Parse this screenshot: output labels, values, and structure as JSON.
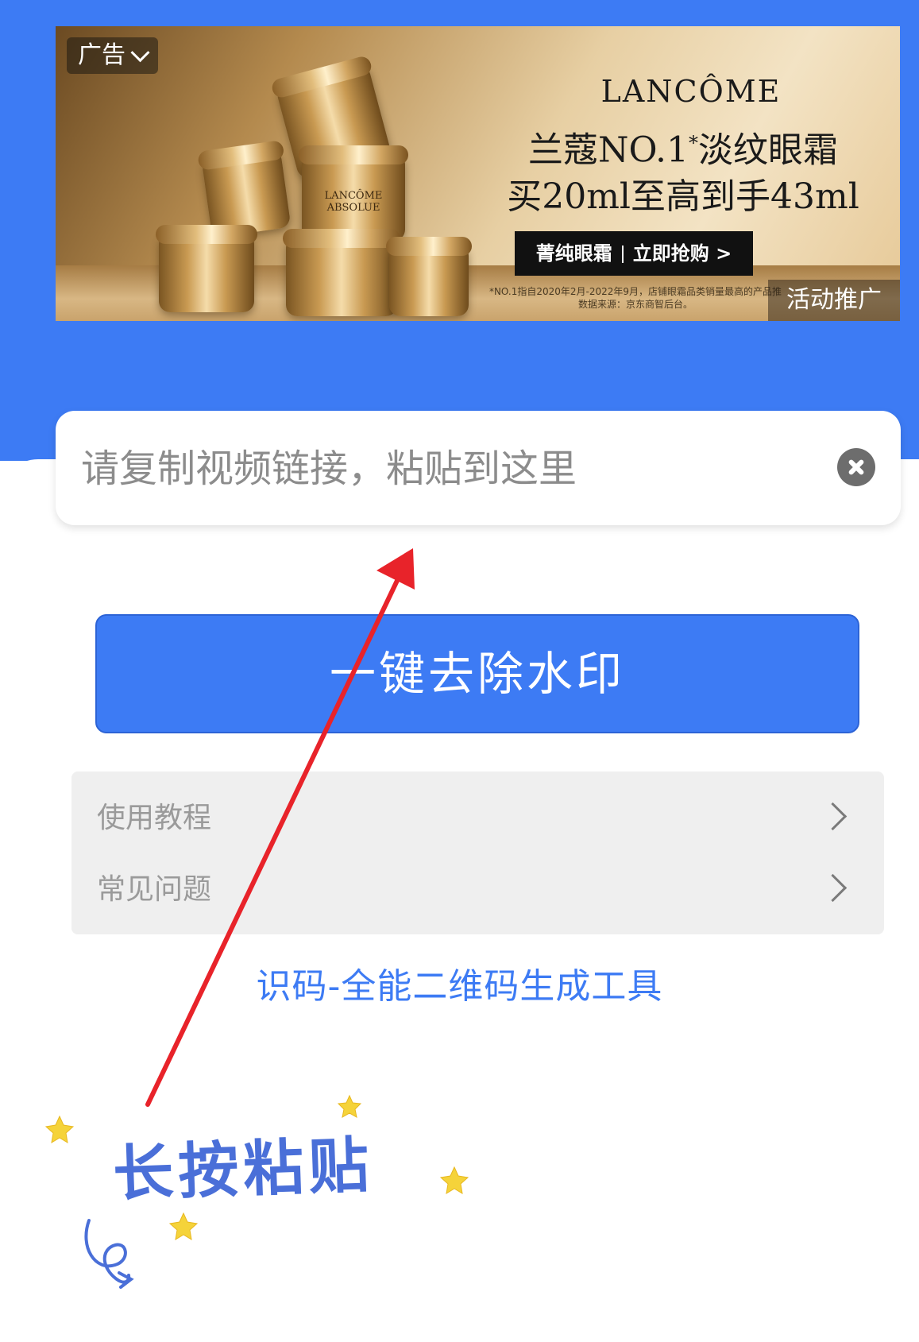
{
  "ad": {
    "tag_label": "广告",
    "brand": "LANCÔME",
    "headline_line1_a": "兰蔻NO.1",
    "headline_line1_sup": "*",
    "headline_line1_b": "淡纹眼霜",
    "headline_line2": "买20ml至高到手43ml",
    "cta_left": "菁纯眼霜",
    "cta_right": "立即抢购 >",
    "footnote_line1": "*NO.1指自2020年2月-2022年9月，店铺眼霜品类销量最高的产品推",
    "footnote_line2": "数据来源：京东商智后台。",
    "promo_label": "活动推广",
    "jar_label": "LANCÔME ABSOLUE"
  },
  "input": {
    "placeholder": "请复制视频链接，粘贴到这里",
    "value": ""
  },
  "primary_button": {
    "label": "一键去除水印"
  },
  "menu": {
    "items": [
      {
        "label": "使用教程"
      },
      {
        "label": "常见问题"
      }
    ]
  },
  "tool_link": {
    "label": "识码-全能二维码生成工具"
  },
  "annotation": {
    "hint_text": "长按粘贴",
    "arrow_color": "#e8232a",
    "star_color": "#f5d33a",
    "hint_color": "#4a6fd8"
  },
  "colors": {
    "primary": "#3d7bf4",
    "panel": "#efefef"
  }
}
